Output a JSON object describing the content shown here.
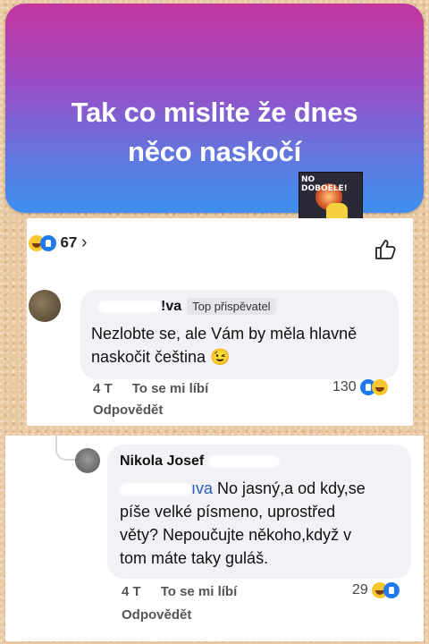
{
  "post": {
    "text_line1": "Tak co mislite že dnes",
    "text_line2": "něco naskočí",
    "meme_caption": "NO DOBOELE!"
  },
  "post_reactions": {
    "count": "67",
    "chevron": "›"
  },
  "comment1": {
    "author_suffix": "!va",
    "badge": "Top přispěvatel",
    "text_line1": "Nezlobte se, ale Vám by měla hlavně",
    "text_line2": "naskočit čeština 😉",
    "time": "4 T",
    "like_label": "To se mi líbí",
    "reply_label": "Odpovědět",
    "reaction_count": "130"
  },
  "comment2": {
    "author": "Nikola Josef",
    "mention_suffix": "ıva",
    "text_line1_rest": "No jasný,a od kdy,se",
    "text_line2": "píše velké písmeno, uprostřed",
    "text_line3": "věty? Nepoučujte někoho,když v",
    "text_line4": "tom máte taky guláš.",
    "time": "4 T",
    "like_label": "To se mi líbí",
    "reply_label": "Odpovědět",
    "reaction_count": "29"
  },
  "colors": {
    "gradient_top": "#c3359e",
    "gradient_bottom": "#3d8ff0",
    "like_blue": "#1f7af2",
    "haha_yellow": "#f7c72f"
  }
}
